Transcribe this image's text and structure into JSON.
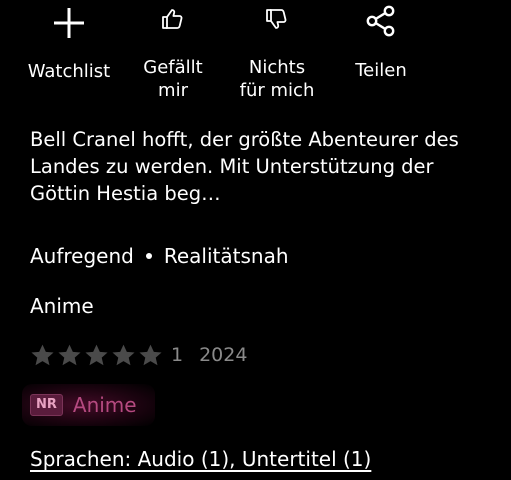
{
  "actions": [
    {
      "label": "Watchlist",
      "icon": "plus-icon"
    },
    {
      "label": "Gefällt\nmir",
      "icon": "thumbs-up-icon"
    },
    {
      "label": "Nichts\nfür mich",
      "icon": "thumbs-down-icon"
    },
    {
      "label": "Teilen",
      "icon": "share-icon"
    }
  ],
  "description": "Bell Cranel hofft, der größte Abenteurer des Landes zu werden. Mit Unterstützung der Göttin Hestia beg…",
  "tags": [
    "Aufregend",
    "Realitätsnah"
  ],
  "genre": "Anime",
  "rating": {
    "stars_filled": 0,
    "stars_total": 5,
    "count": "1",
    "year": "2024",
    "star_color": "#4a4a4a"
  },
  "maturity": {
    "badge": "NR",
    "genre": "Anime",
    "accent": "#b54a80"
  },
  "languages": "Sprachen: Audio (1), Untertitel (1)"
}
